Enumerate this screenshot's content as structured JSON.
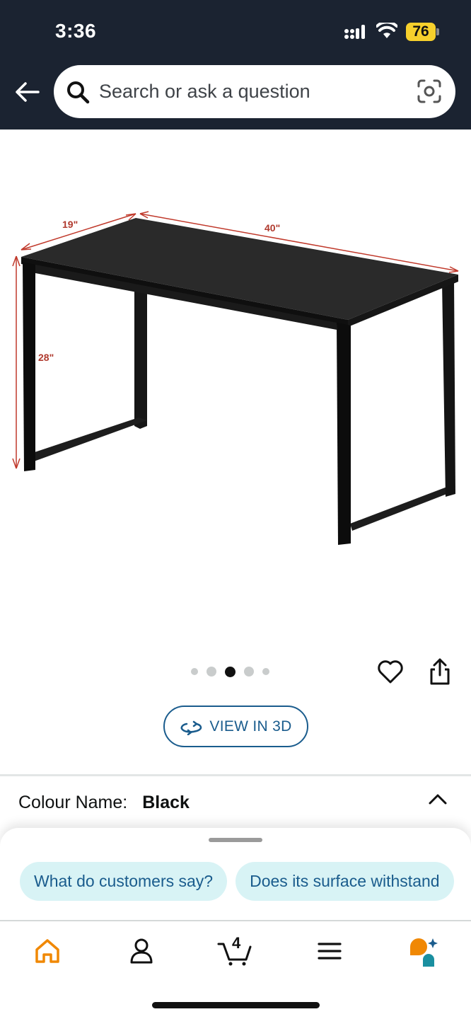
{
  "status_bar": {
    "time": "3:36",
    "battery": "76"
  },
  "search": {
    "placeholder": "Search or ask a question"
  },
  "product_image": {
    "dimensions": {
      "depth": "19\"",
      "width": "40\"",
      "height": "28\""
    }
  },
  "carousel": {
    "total": 5,
    "active_index": 2
  },
  "view3d": {
    "label": "VIEW IN 3D"
  },
  "colour": {
    "label": "Colour Name:",
    "value": "Black"
  },
  "chips": [
    {
      "label": "What do customers say?"
    },
    {
      "label": "Does its surface withstand"
    }
  ],
  "tabbar": {
    "cart_count": "4"
  },
  "colors": {
    "header_bg": "#1b2331",
    "accent_orange": "#f08804",
    "link_blue": "#1a5c8d",
    "chip_bg": "#d8f3f5"
  }
}
